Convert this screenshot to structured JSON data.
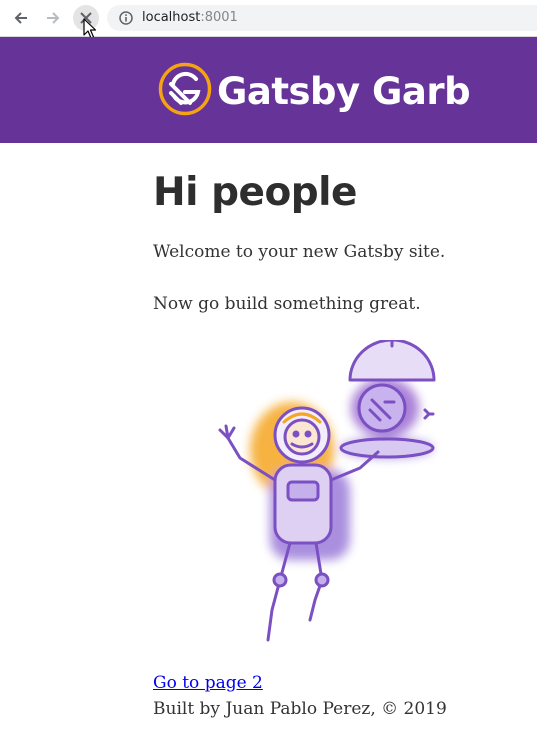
{
  "browser": {
    "url_host": "localhost",
    "url_port": ":8001",
    "icons": [
      "back-arrow-icon",
      "forward-arrow-icon",
      "stop-loading-icon",
      "info-icon",
      "mouse-cursor-icon"
    ]
  },
  "header": {
    "title": "Gatsby Garb",
    "background": "#663399",
    "logo_color": "#f6a313"
  },
  "main": {
    "heading": "Hi people",
    "paragraphs": [
      "Welcome to your new Gatsby site.",
      "Now go build something great."
    ],
    "link_label": "Go to page 2"
  },
  "footer": {
    "text": "Built by Juan Pablo Perez, © 2019"
  }
}
